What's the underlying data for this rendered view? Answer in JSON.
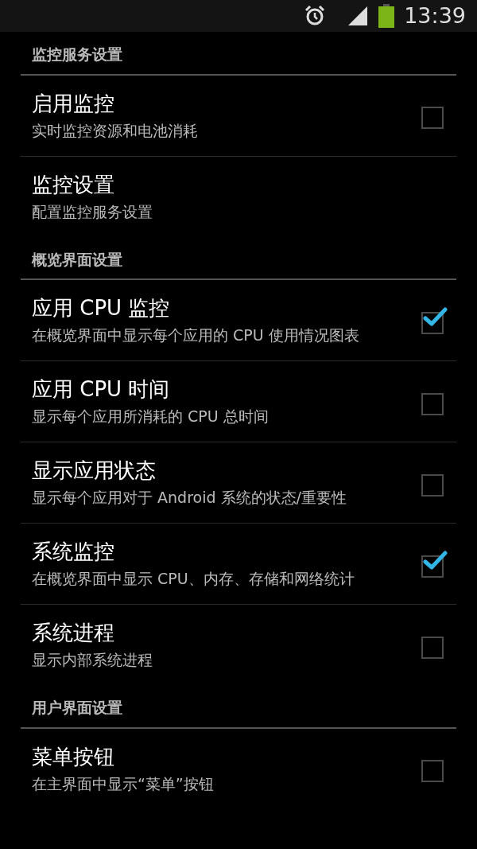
{
  "status_bar": {
    "time": "13:39"
  },
  "sections": [
    {
      "title": "监控服务设置",
      "items": [
        {
          "title": "启用监控",
          "summary": "实时监控资源和电池消耗",
          "checked": false
        },
        {
          "title": "监控设置",
          "summary": "配置监控服务设置"
        }
      ]
    },
    {
      "title": "概览界面设置",
      "items": [
        {
          "title": "应用 CPU 监控",
          "summary": "在概览界面中显示每个应用的 CPU 使用情况图表",
          "checked": true
        },
        {
          "title": "应用 CPU 时间",
          "summary": "显示每个应用所消耗的 CPU 总时间",
          "checked": false
        },
        {
          "title": "显示应用状态",
          "summary": "显示每个应用对于 Android 系统的状态/重要性",
          "checked": false
        },
        {
          "title": "系统监控",
          "summary": "在概览界面中显示 CPU、内存、存储和网络统计",
          "checked": true
        },
        {
          "title": "系统进程",
          "summary": "显示内部系统进程",
          "checked": false
        }
      ]
    },
    {
      "title": "用户界面设置",
      "items": [
        {
          "title": "菜单按钮",
          "summary": "在主界面中显示“菜单”按钮",
          "checked": false
        }
      ]
    }
  ]
}
